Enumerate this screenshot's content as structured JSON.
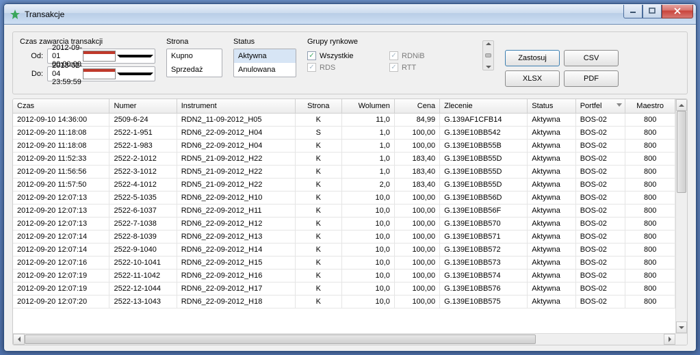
{
  "window": {
    "title": "Transakcje"
  },
  "filters": {
    "time_label": "Czas zawarcia transakcji",
    "from_label": "Od:",
    "to_label": "Do:",
    "from_value": "2012-09-01 00:00:00",
    "to_value": "2013-02-04 23:59:59",
    "side_label": "Strona",
    "side_options": {
      "buy": "Kupno",
      "sell": "Sprzedaż"
    },
    "status_label": "Status",
    "status_options": {
      "active": "Aktywna",
      "cancelled": "Anulowana"
    },
    "groups_label": "Grupy rynkowe",
    "groups": {
      "all": "Wszystkie",
      "rds": "RDS",
      "rdnib": "RDNiB",
      "rtt": "RTT"
    }
  },
  "buttons": {
    "apply": "Zastosuj",
    "csv": "CSV",
    "xlsx": "XLSX",
    "pdf": "PDF"
  },
  "table": {
    "headers": {
      "czas": "Czas",
      "numer": "Numer",
      "instrument": "Instrument",
      "strona": "Strona",
      "wolumen": "Wolumen",
      "cena": "Cena",
      "zlecenie": "Zlecenie",
      "status": "Status",
      "portfel": "Portfel",
      "maestro": "Maestro"
    },
    "rows": [
      {
        "czas": "2012-09-10 14:36:00",
        "numer": "2509-6-24",
        "instrument": "RDN2_11-09-2012_H05",
        "strona": "K",
        "wolumen": "11,0",
        "cena": "84,99",
        "zlecenie": "G.139AF1CFB14",
        "status": "Aktywna",
        "portfel": "BOS-02",
        "maestro": "800"
      },
      {
        "czas": "2012-09-20 11:18:08",
        "numer": "2522-1-951",
        "instrument": "RDN6_22-09-2012_H04",
        "strona": "S",
        "wolumen": "1,0",
        "cena": "100,00",
        "zlecenie": "G.139E10BB542",
        "status": "Aktywna",
        "portfel": "BOS-02",
        "maestro": "800"
      },
      {
        "czas": "2012-09-20 11:18:08",
        "numer": "2522-1-983",
        "instrument": "RDN6_22-09-2012_H04",
        "strona": "K",
        "wolumen": "1,0",
        "cena": "100,00",
        "zlecenie": "G.139E10BB55B",
        "status": "Aktywna",
        "portfel": "BOS-02",
        "maestro": "800"
      },
      {
        "czas": "2012-09-20 11:52:33",
        "numer": "2522-2-1012",
        "instrument": "RDN5_21-09-2012_H22",
        "strona": "K",
        "wolumen": "1,0",
        "cena": "183,40",
        "zlecenie": "G.139E10BB55D",
        "status": "Aktywna",
        "portfel": "BOS-02",
        "maestro": "800"
      },
      {
        "czas": "2012-09-20 11:56:56",
        "numer": "2522-3-1012",
        "instrument": "RDN5_21-09-2012_H22",
        "strona": "K",
        "wolumen": "1,0",
        "cena": "183,40",
        "zlecenie": "G.139E10BB55D",
        "status": "Aktywna",
        "portfel": "BOS-02",
        "maestro": "800"
      },
      {
        "czas": "2012-09-20 11:57:50",
        "numer": "2522-4-1012",
        "instrument": "RDN5_21-09-2012_H22",
        "strona": "K",
        "wolumen": "2,0",
        "cena": "183,40",
        "zlecenie": "G.139E10BB55D",
        "status": "Aktywna",
        "portfel": "BOS-02",
        "maestro": "800"
      },
      {
        "czas": "2012-09-20 12:07:13",
        "numer": "2522-5-1035",
        "instrument": "RDN6_22-09-2012_H10",
        "strona": "K",
        "wolumen": "10,0",
        "cena": "100,00",
        "zlecenie": "G.139E10BB56D",
        "status": "Aktywna",
        "portfel": "BOS-02",
        "maestro": "800"
      },
      {
        "czas": "2012-09-20 12:07:13",
        "numer": "2522-6-1037",
        "instrument": "RDN6_22-09-2012_H11",
        "strona": "K",
        "wolumen": "10,0",
        "cena": "100,00",
        "zlecenie": "G.139E10BB56F",
        "status": "Aktywna",
        "portfel": "BOS-02",
        "maestro": "800"
      },
      {
        "czas": "2012-09-20 12:07:13",
        "numer": "2522-7-1038",
        "instrument": "RDN6_22-09-2012_H12",
        "strona": "K",
        "wolumen": "10,0",
        "cena": "100,00",
        "zlecenie": "G.139E10BB570",
        "status": "Aktywna",
        "portfel": "BOS-02",
        "maestro": "800"
      },
      {
        "czas": "2012-09-20 12:07:14",
        "numer": "2522-8-1039",
        "instrument": "RDN6_22-09-2012_H13",
        "strona": "K",
        "wolumen": "10,0",
        "cena": "100,00",
        "zlecenie": "G.139E10BB571",
        "status": "Aktywna",
        "portfel": "BOS-02",
        "maestro": "800"
      },
      {
        "czas": "2012-09-20 12:07:14",
        "numer": "2522-9-1040",
        "instrument": "RDN6_22-09-2012_H14",
        "strona": "K",
        "wolumen": "10,0",
        "cena": "100,00",
        "zlecenie": "G.139E10BB572",
        "status": "Aktywna",
        "portfel": "BOS-02",
        "maestro": "800"
      },
      {
        "czas": "2012-09-20 12:07:16",
        "numer": "2522-10-1041",
        "instrument": "RDN6_22-09-2012_H15",
        "strona": "K",
        "wolumen": "10,0",
        "cena": "100,00",
        "zlecenie": "G.139E10BB573",
        "status": "Aktywna",
        "portfel": "BOS-02",
        "maestro": "800"
      },
      {
        "czas": "2012-09-20 12:07:19",
        "numer": "2522-11-1042",
        "instrument": "RDN6_22-09-2012_H16",
        "strona": "K",
        "wolumen": "10,0",
        "cena": "100,00",
        "zlecenie": "G.139E10BB574",
        "status": "Aktywna",
        "portfel": "BOS-02",
        "maestro": "800"
      },
      {
        "czas": "2012-09-20 12:07:19",
        "numer": "2522-12-1044",
        "instrument": "RDN6_22-09-2012_H17",
        "strona": "K",
        "wolumen": "10,0",
        "cena": "100,00",
        "zlecenie": "G.139E10BB576",
        "status": "Aktywna",
        "portfel": "BOS-02",
        "maestro": "800"
      },
      {
        "czas": "2012-09-20 12:07:20",
        "numer": "2522-13-1043",
        "instrument": "RDN6_22-09-2012_H18",
        "strona": "K",
        "wolumen": "10,0",
        "cena": "100,00",
        "zlecenie": "G.139E10BB575",
        "status": "Aktywna",
        "portfel": "BOS-02",
        "maestro": "800"
      }
    ]
  }
}
